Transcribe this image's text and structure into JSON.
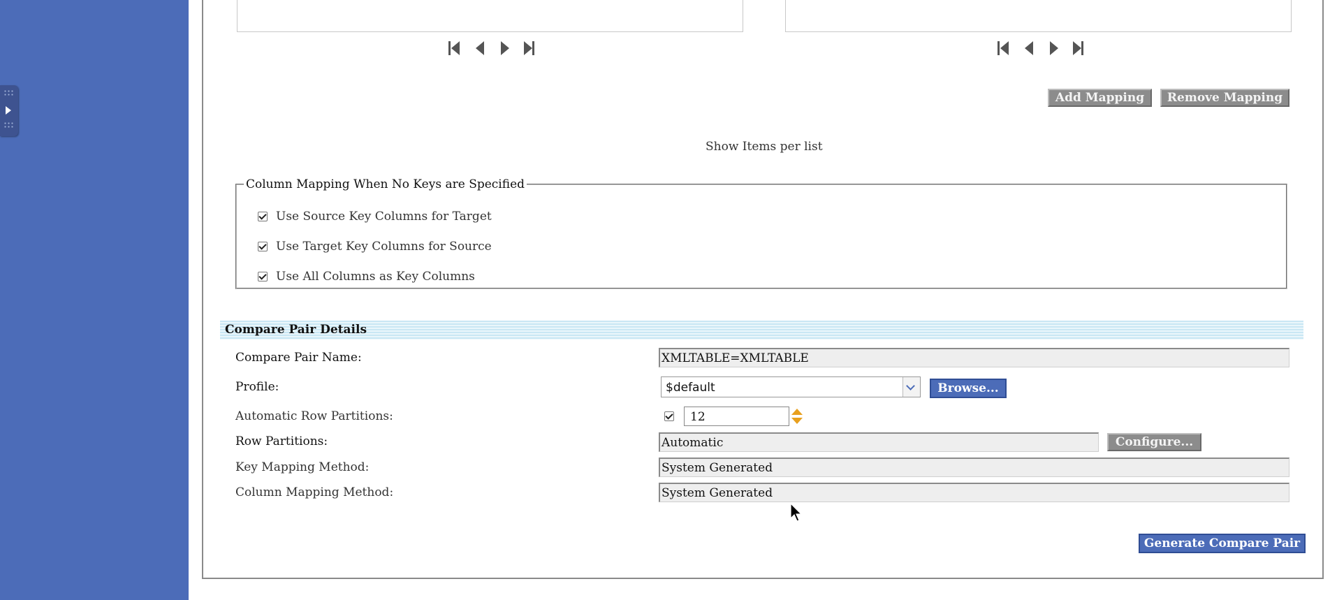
{
  "colors": {
    "sidebar": "#4c6cb8",
    "primary_button": "#4c6cb8",
    "disabled_button": "#8c8c8c",
    "spinner": "#e8a01e",
    "section_header": "#c9e7f4"
  },
  "pager_left": {
    "icons": [
      "first-page-icon",
      "prev-page-icon",
      "next-page-icon",
      "last-page-icon"
    ]
  },
  "pager_right": {
    "icons": [
      "first-page-icon",
      "prev-page-icon",
      "next-page-icon",
      "last-page-icon"
    ]
  },
  "mapping_buttons": {
    "add": "Add Mapping",
    "remove": "Remove Mapping"
  },
  "show_items_label": "Show Items per list",
  "column_mapping": {
    "legend": "Column Mapping When No Keys are Specified",
    "options": [
      {
        "label": "Use Source Key Columns for Target",
        "checked": true
      },
      {
        "label": "Use Target Key Columns for Source",
        "checked": true
      },
      {
        "label": "Use All Columns as Key Columns",
        "checked": true
      }
    ]
  },
  "compare_pair": {
    "header": "Compare Pair Details",
    "name_label": "Compare Pair Name:",
    "name_value": "XMLTABLE=XMLTABLE",
    "profile_label": "Profile:",
    "profile_value": "$default",
    "browse_button": "Browse...",
    "auto_partitions_label": "Automatic Row Partitions:",
    "auto_partitions_checked": true,
    "auto_partitions_value": "12",
    "row_partitions_label": "Row Partitions:",
    "row_partitions_value": "Automatic",
    "configure_button": "Configure...",
    "key_mapping_label": "Key Mapping Method:",
    "key_mapping_value": "System Generated",
    "column_mapping_label": "Column Mapping Method:",
    "column_mapping_value": "System Generated",
    "generate_button": "Generate Compare Pair"
  }
}
